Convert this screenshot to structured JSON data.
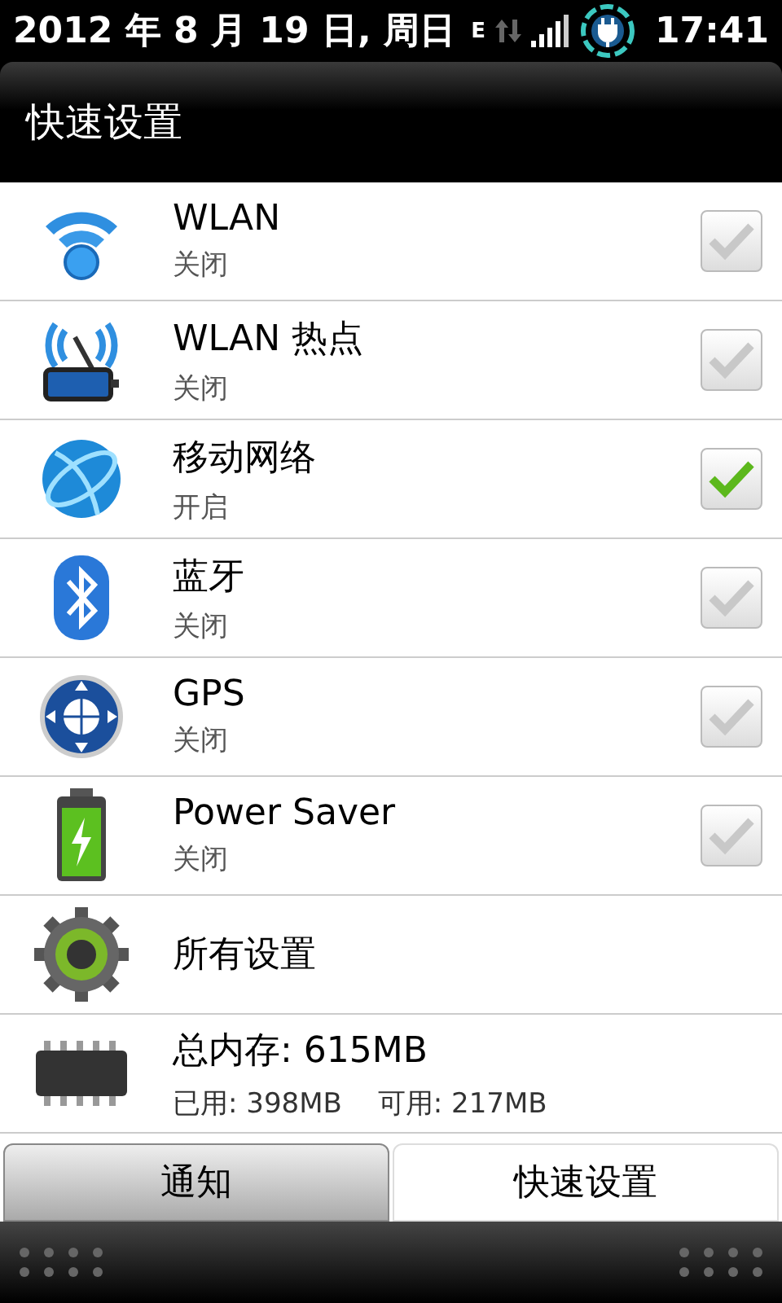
{
  "status_bar": {
    "date": "2012 年 8 月 19 日, 周日",
    "network": "E",
    "time": "17:41"
  },
  "header": {
    "title": "快速设置"
  },
  "items": [
    {
      "kind": "toggle",
      "title": "WLAN",
      "status": "关闭",
      "checked": false
    },
    {
      "kind": "toggle",
      "title": "WLAN 热点",
      "status": "关闭",
      "checked": false
    },
    {
      "kind": "toggle",
      "title": "移动网络",
      "status": "开启",
      "checked": true
    },
    {
      "kind": "toggle",
      "title": "蓝牙",
      "status": "关闭",
      "checked": false
    },
    {
      "kind": "toggle",
      "title": "GPS",
      "status": "关闭",
      "checked": false
    },
    {
      "kind": "toggle",
      "title": "Power Saver",
      "status": "关闭",
      "checked": false
    },
    {
      "kind": "link",
      "title": "所有设置"
    },
    {
      "kind": "memory",
      "title": "总内存: 615MB",
      "used": "已用: 398MB",
      "free": "可用: 217MB"
    }
  ],
  "tabs": [
    {
      "label": "通知",
      "selected": false
    },
    {
      "label": "快速设置",
      "selected": true
    }
  ]
}
